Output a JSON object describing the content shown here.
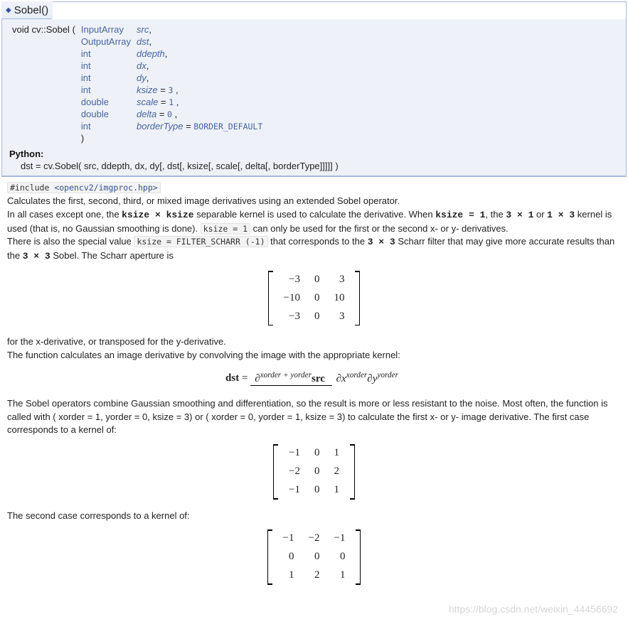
{
  "header": {
    "arrow": "◆",
    "title": "Sobel()"
  },
  "proto": {
    "ret": "void",
    "scope": "cv::Sobel",
    "open": "(",
    "close": ")",
    "params": [
      {
        "type": "InputArray",
        "name": "src",
        "sep": ","
      },
      {
        "type": "OutputArray",
        "name": "dst",
        "sep": ","
      },
      {
        "type": "int",
        "name": "ddepth",
        "sep": ","
      },
      {
        "type": "int",
        "name": "dx",
        "sep": ","
      },
      {
        "type": "int",
        "name": "dy",
        "sep": ","
      },
      {
        "type": "int",
        "name": "ksize",
        "def": "3",
        "sep": " ,"
      },
      {
        "type": "double",
        "name": "scale",
        "def": "1",
        "sep": " ,"
      },
      {
        "type": "double",
        "name": "delta",
        "def": "0",
        "sep": " ,"
      },
      {
        "type": "int",
        "name": "borderType",
        "defconst": "BORDER_DEFAULT",
        "sep": ""
      }
    ]
  },
  "python": {
    "label": "Python:",
    "sig": "dst = cv.Sobel( src, ddepth, dx, dy[, dst[, ksize[, scale[, delta[, borderType]]]]] )"
  },
  "include": {
    "pre": "#include ",
    "path": "<opencv2/imgproc.hpp>"
  },
  "body": {
    "p1": "Calculates the first, second, third, or mixed image derivatives using an extended Sobel operator.",
    "p2a": "In all cases except one, the ",
    "ksize_times": "ksize × ksize",
    "p2b": " separable kernel is used to calculate the derivative. When ",
    "ksize_eq1": "ksize = 1",
    "p2c": ", the ",
    "dim1": "3 × 1",
    "p2d": " or ",
    "dim2": "1 × 3",
    "p2e": " kernel is used (that is, no Gaussian smoothing is done). ",
    "ksize_code": "ksize = 1",
    "p2f": " can only be used for the first or the second x- or y- derivatives.",
    "p3a": "There is also the special value ",
    "filter_scharr": "ksize = FILTER_SCHARR (-1)",
    "p3b": " that corresponds to the ",
    "dim3": "3 × 3",
    "p3c": " Scharr filter that may give more accurate results than the ",
    "dim4": "3 × 3",
    "p3d": " Sobel. The Scharr aperture is",
    "p4": "for the x-derivative, or transposed for the y-derivative.",
    "p5": "The function calculates an image derivative by convolving the image with the appropriate kernel:",
    "p6": "The Sobel operators combine Gaussian smoothing and differentiation, so the result is more or less resistant to the noise. Most often, the function is called with ( xorder = 1, yorder = 0, ksize = 3) or ( xorder = 0, yorder = 1, ksize = 3) to calculate the first x- or y- image derivative. The first case corresponds to a kernel of:",
    "p7": "The second case corresponds to a kernel of:"
  },
  "chart_data": [
    {
      "type": "table",
      "title": "Scharr aperture (x)",
      "rows": [
        [
          "−3",
          "0",
          "3"
        ],
        [
          "−10",
          "0",
          "10"
        ],
        [
          "−3",
          "0",
          "3"
        ]
      ]
    },
    {
      "type": "table",
      "title": "Sobel x kernel",
      "rows": [
        [
          "−1",
          "0",
          "1"
        ],
        [
          "−2",
          "0",
          "2"
        ],
        [
          "−1",
          "0",
          "1"
        ]
      ]
    },
    {
      "type": "table",
      "title": "Sobel y kernel",
      "rows": [
        [
          "−1",
          "−2",
          "−1"
        ],
        [
          "0",
          "0",
          "0"
        ],
        [
          "1",
          "2",
          "1"
        ]
      ]
    }
  ],
  "formula": {
    "lhs": "dst",
    "eq": " = ",
    "partial": "∂",
    "num_exp": "xorder + yorder",
    "num_tail": "src",
    "den_x": "x",
    "den_xexp": "xorder",
    "den_y": "y",
    "den_yexp": "yorder"
  },
  "watermark": "https://blog.csdn.net/weixin_44456692"
}
